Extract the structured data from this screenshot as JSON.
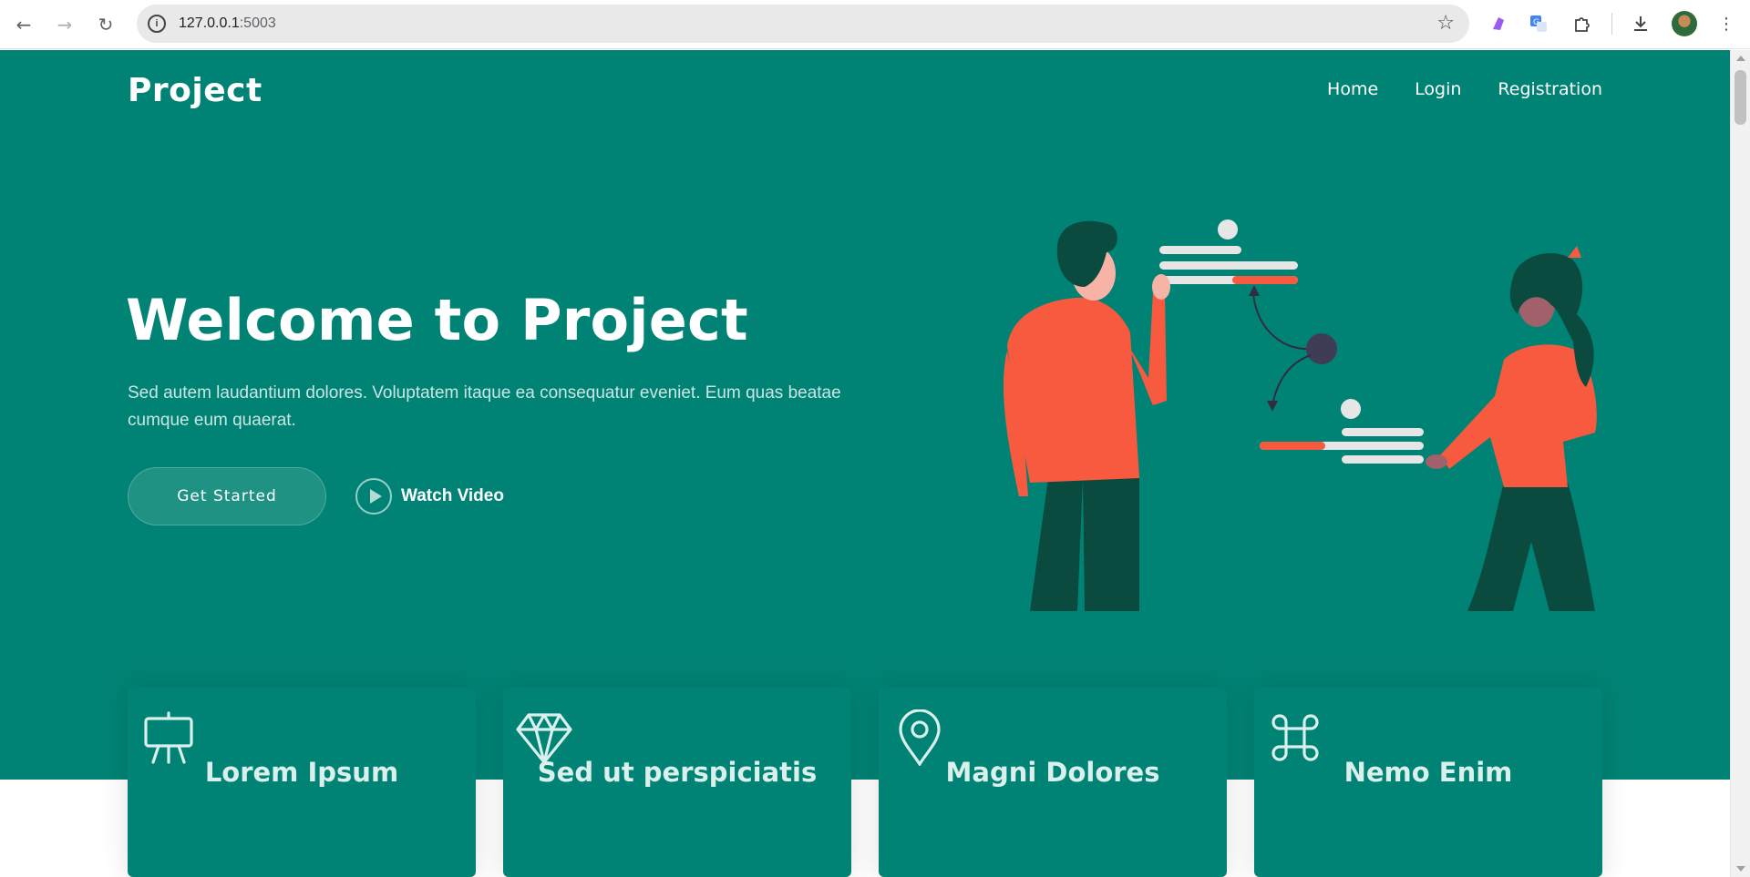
{
  "browser": {
    "url_host": "127.0.0.1",
    "url_port": ":5003"
  },
  "nav": {
    "brand": "Project",
    "items": [
      {
        "label": "Home"
      },
      {
        "label": "Login"
      },
      {
        "label": "Registration"
      }
    ]
  },
  "hero": {
    "title": "Welcome to Project",
    "description": "Sed autem laudantium dolores. Voluptatem itaque ea consequatur eveniet. Eum quas beatae cumque eum quaerat.",
    "primary_button": "Get Started",
    "video_button": "Watch Video"
  },
  "features": [
    {
      "title": "Lorem Ipsum",
      "icon": "easel-icon"
    },
    {
      "title": "Sed ut perspiciatis",
      "icon": "gem-icon"
    },
    {
      "title": "Magni Dolores",
      "icon": "map-pin-icon"
    },
    {
      "title": "Nemo Enim",
      "icon": "command-icon"
    }
  ],
  "colors": {
    "primary": "#008374",
    "accent": "#f85a40",
    "dark_green": "#0b4a3f",
    "text_light": "#c9e6e2"
  }
}
